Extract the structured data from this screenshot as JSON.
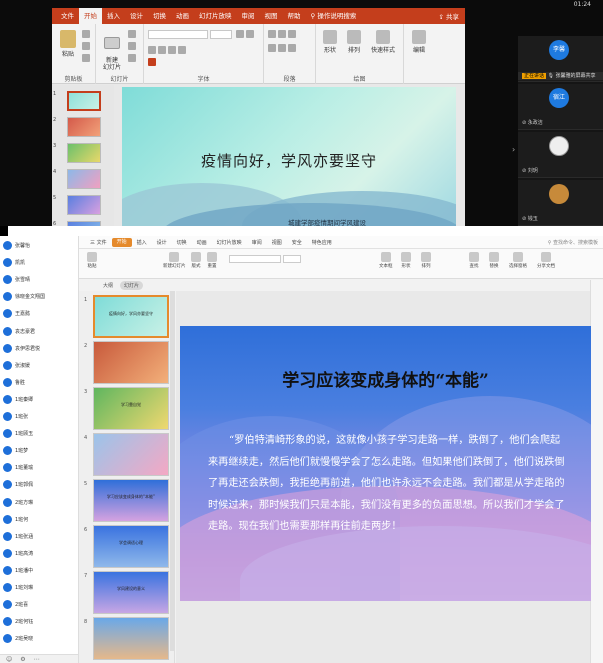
{
  "system": {
    "time": "01:24"
  },
  "ppt": {
    "tabs": [
      "文件",
      "开始",
      "插入",
      "设计",
      "切换",
      "动画",
      "幻灯片放映",
      "审阅",
      "视图",
      "帮助",
      "操作说明搜索"
    ],
    "active_tab": "开始",
    "share": "共享",
    "buttons": {
      "paste": "粘贴",
      "new_slide": "新建\n幻灯片",
      "shape": "形状",
      "arrange": "排列",
      "quick_style": "快速样式",
      "edit": "编辑"
    },
    "groups": [
      "剪贴板",
      "幻灯片",
      "字体",
      "段落",
      "绘图"
    ],
    "thumb_numbers": [
      "1",
      "2",
      "3",
      "4",
      "5",
      "6"
    ],
    "slide": {
      "title": "疫情向好，学风亦要坚守",
      "subtitle": "城建学部疫情期间学风建设"
    }
  },
  "meeting_panel": {
    "participants": [
      {
        "initials": "李馨",
        "name": ""
      },
      {
        "initials": "宿江",
        "name": "永政洁"
      },
      {
        "initials": "",
        "name": "刘玥"
      },
      {
        "initials": "",
        "name": "钱玉"
      }
    ],
    "speaking_bar": {
      "highlight": "正在讲话",
      "text": "张馨雅的屏幕共享"
    }
  },
  "members": [
    "张馨怡",
    "凯凯",
    "张雪晴",
    "徐晓金文翔国",
    "王嘉懿",
    "袁志豪君",
    "袁伊思君悦",
    "张淑媛",
    "鲁胜",
    "1班秦卿",
    "1班张",
    "1班顾玉",
    "1班梦",
    "1班董瑜",
    "1班郭佩",
    "2班方琳",
    "1班何",
    "1班张涵",
    "1班高涛",
    "1班潘中",
    "1班刘琳",
    "2班喜",
    "2班何钰",
    "2班吴晓"
  ],
  "wps": {
    "menu_tabs": [
      "三 文件",
      "开始",
      "插入",
      "设计",
      "切换",
      "动画",
      "幻灯片放映",
      "审阅",
      "视图",
      "安全",
      "特色应用"
    ],
    "active_tab": "开始",
    "search": "查找命令、搜索模板",
    "tools": [
      "粘贴",
      "新建幻灯片",
      "版式",
      "重置",
      "文本框",
      "形状",
      "排列",
      "查找",
      "替换",
      "选择窗格",
      "分享文档"
    ],
    "view_tabs": [
      "大纲",
      "幻灯片"
    ],
    "active_view": "幻灯片",
    "thumbs": [
      {
        "num": "1",
        "text": "疫情向好，学风亦要坚守"
      },
      {
        "num": "2",
        "text": ""
      },
      {
        "num": "3",
        "text": "学习靠自觉"
      },
      {
        "num": "4",
        "text": ""
      },
      {
        "num": "5",
        "text": "学习应该变成身体的“本能”"
      },
      {
        "num": "6",
        "text": "学会调适心理"
      },
      {
        "num": "7",
        "text": "学风建设的意义"
      },
      {
        "num": "8",
        "text": ""
      }
    ],
    "slide": {
      "title": "学习应该变成身体的“本能”",
      "body": "“罗伯特清崎形象的说，这就像小孩子学习走路一样，跌倒了，他们会爬起来再继续走，然后他们就慢慢学会了怎么走路。但如果他们跌倒了，他们说跌倒了再走还会跌倒，我拒绝再前进，他们也许永远不会走路。我们都是从学走路的时候过来，那时候我们只是本能，我们没有更多的负面思想。所以我们才学会了走路。现在我们也需要那样再往前走两步！"
    }
  }
}
